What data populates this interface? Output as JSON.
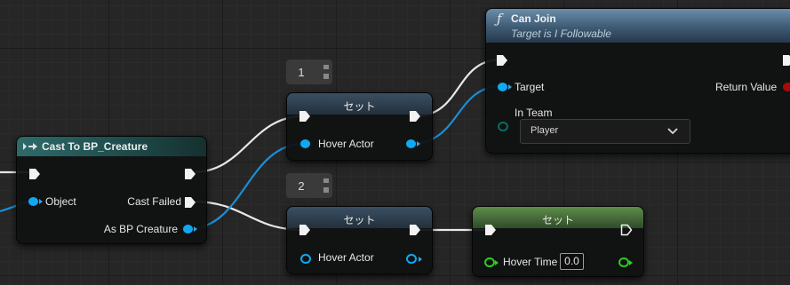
{
  "nodes": {
    "cast": {
      "title": "Cast To BP_Creature",
      "pins": {
        "object": "Object",
        "cast_failed": "Cast Failed",
        "as_creature": "As BP Creature"
      }
    },
    "set1": {
      "title": "セット",
      "badge": "1",
      "pin": "Hover Actor"
    },
    "set2": {
      "title": "セット",
      "badge": "2",
      "pin": "Hover Actor"
    },
    "set3": {
      "title": "セット",
      "pin": "Hover Time",
      "value": "0.0"
    },
    "can_join": {
      "title": "Can Join",
      "subtitle": "Target is I Followable",
      "pins": {
        "target": "Target",
        "return_value": "Return Value",
        "in_team": "In Team"
      },
      "dropdown_value": "Player"
    }
  },
  "icons": [
    "cast-icon",
    "function-icon",
    "dropdown-chevron-icon"
  ],
  "colors": {
    "exec": "#ffffff",
    "object_pin": "#0fa8f2",
    "float_pin": "#2ecc20",
    "bool_pin": "#a80b0b",
    "enum_pin": "#0b6b63",
    "cast_header": "#1f4d4c",
    "set_header": "#2b3a47",
    "set_float_header": "#4b7a3a",
    "function_header": "#5a7d99"
  }
}
